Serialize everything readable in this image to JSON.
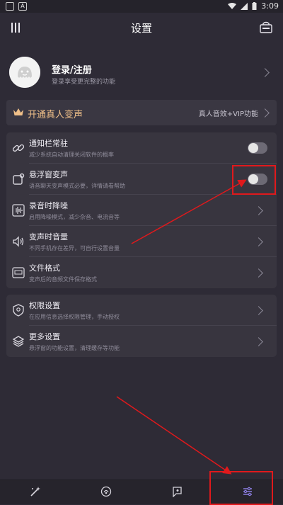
{
  "status_bar": {
    "time": "3:09",
    "notif_letter": "A"
  },
  "header": {
    "title": "设置"
  },
  "login": {
    "title": "登录/注册",
    "subtitle": "登录享受更完整的功能"
  },
  "vip": {
    "title": "开通真人变声",
    "right_text": "真人音效+VIP功能"
  },
  "settings_group_1": [
    {
      "title": "通知栏常驻",
      "subtitle": "减少系统自动清理关闭软件的概率",
      "control": "toggle",
      "state": "off"
    },
    {
      "title": "悬浮窗变声",
      "subtitle": "语音聊天变声模式必要，详情请看帮助",
      "control": "toggle",
      "state": "off"
    },
    {
      "title": "录音时降噪",
      "subtitle": "启用降噪模式，减少杂音、电流音等",
      "control": "chevron"
    },
    {
      "title": "变声时音量",
      "subtitle": "不同手机存在差异，可自行设置音量",
      "control": "chevron"
    },
    {
      "title": "文件格式",
      "subtitle": "变声后的音频文件保存格式",
      "control": "chevron"
    }
  ],
  "settings_group_2": [
    {
      "title": "权限设置",
      "subtitle": "在应用信息选择权限管理，手动授权",
      "control": "chevron"
    },
    {
      "title": "更多设置",
      "subtitle": "悬浮窗的功能设置，清理缓存等功能",
      "control": "chevron"
    }
  ],
  "bottom_nav": [
    "magic-wand-icon",
    "voice-globe-icon",
    "chat-icon",
    "settings-sliders-icon"
  ],
  "colors": {
    "background": "#2e2b36",
    "card": "#38353f",
    "vip_gold": "#f0c089",
    "annotation": "#e0191c",
    "active_nav": "#8a7de0"
  }
}
